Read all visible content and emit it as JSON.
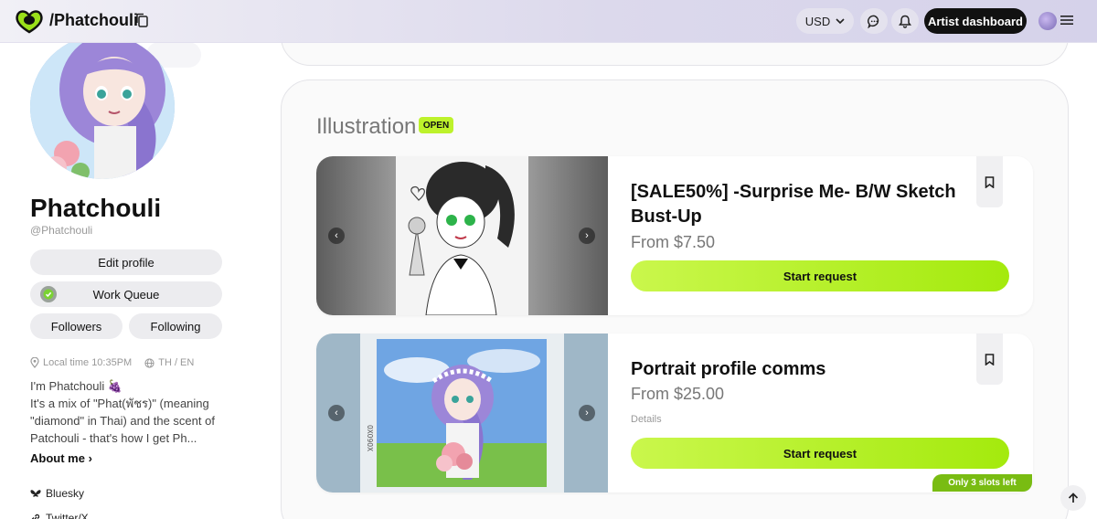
{
  "header": {
    "handle": "/Phatchouli",
    "currency": "USD",
    "artist_dashboard": "Artist dashboard"
  },
  "profile": {
    "display_name": "Phatchouli",
    "username": "@Phatchouli",
    "edit_profile": "Edit profile",
    "work_queue": "Work Queue",
    "followers": "Followers",
    "following": "Following",
    "local_time": "Local time 10:35PM",
    "languages": "TH / EN",
    "bio": [
      "I'm Phatchouli 🍇",
      "It's a mix of \"Phat(พัชร)\" (meaning",
      "\"diamond\" in Thai) and the scent of",
      "Patchouli - that's how I get Ph..."
    ],
    "about_me": "About me",
    "socials": [
      "Bluesky",
      "Twitter/X"
    ]
  },
  "section": {
    "title": "Illustration",
    "badge": "OPEN"
  },
  "listings": [
    {
      "title": "[SALE50%] -Surprise Me- B/W Sketch Bust-Up",
      "price": "From $7.50",
      "cta": "Start request"
    },
    {
      "title": "Portrait profile comms",
      "price": "From $25.00",
      "details": "Details",
      "cta": "Start request",
      "slots": "Only 3 slots left"
    }
  ],
  "icons": {
    "logo": "brand-logo-icon",
    "copy": "copy-icon",
    "chevron": "chevron-down-icon",
    "chat": "chat-icon",
    "bell": "bell-icon",
    "menu": "menu-icon",
    "bookmark": "bookmark-icon",
    "pin": "location-pin-icon",
    "globe": "globe-icon",
    "butterfly": "butterfly-icon",
    "link": "link-icon",
    "arrow_up": "arrow-up-icon"
  },
  "colors": {
    "accent_green": "#a4ea0d",
    "badge_green": "#bdf22b",
    "slots_green": "#79bc12",
    "dark_button": "#111111"
  }
}
